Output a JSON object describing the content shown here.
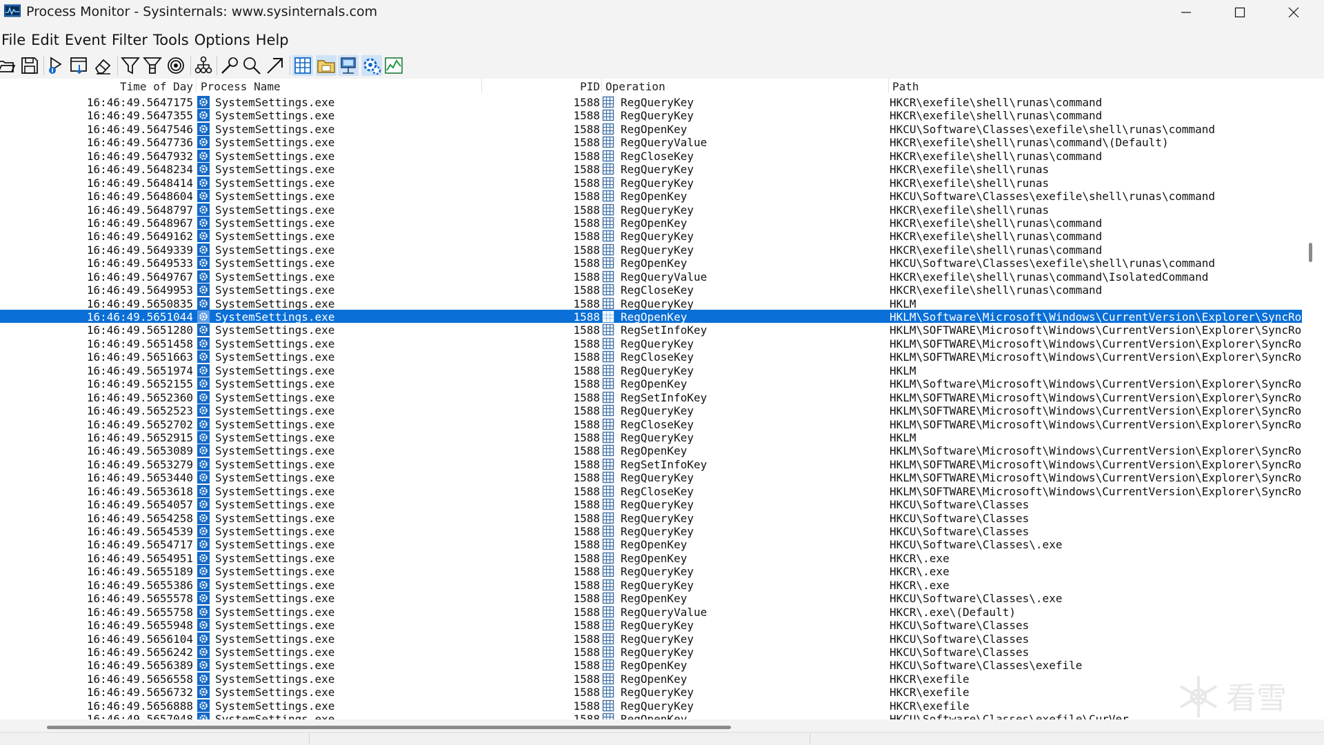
{
  "window": {
    "title": "Process Monitor - Sysinternals: www.sysinternals.com",
    "icon": "process-monitor-app-icon",
    "controls": [
      "minimize-icon",
      "maximize-icon",
      "close-icon"
    ]
  },
  "menu": [
    "File",
    "Edit",
    "Event",
    "Filter",
    "Tools",
    "Options",
    "Help"
  ],
  "toolbar": [
    {
      "name": "open-icon"
    },
    {
      "name": "save-icon"
    },
    {
      "name": "capture-icon"
    },
    {
      "name": "autoscroll-icon"
    },
    {
      "name": "clear-icon"
    },
    {
      "name": "filter-icon"
    },
    {
      "name": "highlight-icon"
    },
    {
      "name": "include-process-icon"
    },
    {
      "name": "process-tree-icon"
    },
    {
      "name": "find-icon"
    },
    {
      "name": "jump-to-icon"
    },
    {
      "name": "registry-activity-icon"
    },
    {
      "name": "file-system-activity-icon"
    },
    {
      "name": "network-activity-icon"
    },
    {
      "name": "process-thread-activity-icon"
    },
    {
      "name": "profiling-events-icon"
    }
  ],
  "columns": {
    "time": "Time of Day",
    "process": "Process Name",
    "pid": "PID",
    "operation": "Operation",
    "path": "Path"
  },
  "colors": {
    "selection": "#0a6fd6",
    "process_icon": "#1469c7",
    "op_icon": "#3d6fa8"
  },
  "rows": [
    {
      "time": "16:46:49.5647175",
      "process": "SystemSettings.exe",
      "pid": "1588",
      "op": "RegQueryKey",
      "path": "HKCR\\exefile\\shell\\runas\\command"
    },
    {
      "time": "16:46:49.5647355",
      "process": "SystemSettings.exe",
      "pid": "1588",
      "op": "RegQueryKey",
      "path": "HKCR\\exefile\\shell\\runas\\command"
    },
    {
      "time": "16:46:49.5647546",
      "process": "SystemSettings.exe",
      "pid": "1588",
      "op": "RegOpenKey",
      "path": "HKCU\\Software\\Classes\\exefile\\shell\\runas\\command"
    },
    {
      "time": "16:46:49.5647736",
      "process": "SystemSettings.exe",
      "pid": "1588",
      "op": "RegQueryValue",
      "path": "HKCR\\exefile\\shell\\runas\\command\\(Default)"
    },
    {
      "time": "16:46:49.5647932",
      "process": "SystemSettings.exe",
      "pid": "1588",
      "op": "RegCloseKey",
      "path": "HKCR\\exefile\\shell\\runas\\command"
    },
    {
      "time": "16:46:49.5648234",
      "process": "SystemSettings.exe",
      "pid": "1588",
      "op": "RegQueryKey",
      "path": "HKCR\\exefile\\shell\\runas"
    },
    {
      "time": "16:46:49.5648414",
      "process": "SystemSettings.exe",
      "pid": "1588",
      "op": "RegQueryKey",
      "path": "HKCR\\exefile\\shell\\runas"
    },
    {
      "time": "16:46:49.5648604",
      "process": "SystemSettings.exe",
      "pid": "1588",
      "op": "RegOpenKey",
      "path": "HKCU\\Software\\Classes\\exefile\\shell\\runas\\command"
    },
    {
      "time": "16:46:49.5648797",
      "process": "SystemSettings.exe",
      "pid": "1588",
      "op": "RegQueryKey",
      "path": "HKCR\\exefile\\shell\\runas"
    },
    {
      "time": "16:46:49.5648967",
      "process": "SystemSettings.exe",
      "pid": "1588",
      "op": "RegOpenKey",
      "path": "HKCR\\exefile\\shell\\runas\\command"
    },
    {
      "time": "16:46:49.5649162",
      "process": "SystemSettings.exe",
      "pid": "1588",
      "op": "RegQueryKey",
      "path": "HKCR\\exefile\\shell\\runas\\command"
    },
    {
      "time": "16:46:49.5649339",
      "process": "SystemSettings.exe",
      "pid": "1588",
      "op": "RegQueryKey",
      "path": "HKCR\\exefile\\shell\\runas\\command"
    },
    {
      "time": "16:46:49.5649533",
      "process": "SystemSettings.exe",
      "pid": "1588",
      "op": "RegOpenKey",
      "path": "HKCU\\Software\\Classes\\exefile\\shell\\runas\\command"
    },
    {
      "time": "16:46:49.5649767",
      "process": "SystemSettings.exe",
      "pid": "1588",
      "op": "RegQueryValue",
      "path": "HKCR\\exefile\\shell\\runas\\command\\IsolatedCommand"
    },
    {
      "time": "16:46:49.5649953",
      "process": "SystemSettings.exe",
      "pid": "1588",
      "op": "RegCloseKey",
      "path": "HKCR\\exefile\\shell\\runas\\command"
    },
    {
      "time": "16:46:49.5650835",
      "process": "SystemSettings.exe",
      "pid": "1588",
      "op": "RegQueryKey",
      "path": "HKLM"
    },
    {
      "time": "16:46:49.5651044",
      "process": "SystemSettings.exe",
      "pid": "1588",
      "op": "RegOpenKey",
      "path": "HKLM\\Software\\Microsoft\\Windows\\CurrentVersion\\Explorer\\SyncRoot\\",
      "selected": true
    },
    {
      "time": "16:46:49.5651280",
      "process": "SystemSettings.exe",
      "pid": "1588",
      "op": "RegSetInfoKey",
      "path": "HKLM\\SOFTWARE\\Microsoft\\Windows\\CurrentVersion\\Explorer\\SyncRoot\\"
    },
    {
      "time": "16:46:49.5651458",
      "process": "SystemSettings.exe",
      "pid": "1588",
      "op": "RegQueryKey",
      "path": "HKLM\\SOFTWARE\\Microsoft\\Windows\\CurrentVersion\\Explorer\\SyncRoot\\"
    },
    {
      "time": "16:46:49.5651663",
      "process": "SystemSettings.exe",
      "pid": "1588",
      "op": "RegCloseKey",
      "path": "HKLM\\SOFTWARE\\Microsoft\\Windows\\CurrentVersion\\Explorer\\SyncRoot\\"
    },
    {
      "time": "16:46:49.5651974",
      "process": "SystemSettings.exe",
      "pid": "1588",
      "op": "RegQueryKey",
      "path": "HKLM"
    },
    {
      "time": "16:46:49.5652155",
      "process": "SystemSettings.exe",
      "pid": "1588",
      "op": "RegOpenKey",
      "path": "HKLM\\Software\\Microsoft\\Windows\\CurrentVersion\\Explorer\\SyncRoot\\"
    },
    {
      "time": "16:46:49.5652360",
      "process": "SystemSettings.exe",
      "pid": "1588",
      "op": "RegSetInfoKey",
      "path": "HKLM\\SOFTWARE\\Microsoft\\Windows\\CurrentVersion\\Explorer\\SyncRoot\\"
    },
    {
      "time": "16:46:49.5652523",
      "process": "SystemSettings.exe",
      "pid": "1588",
      "op": "RegQueryKey",
      "path": "HKLM\\SOFTWARE\\Microsoft\\Windows\\CurrentVersion\\Explorer\\SyncRoot\\"
    },
    {
      "time": "16:46:49.5652702",
      "process": "SystemSettings.exe",
      "pid": "1588",
      "op": "RegCloseKey",
      "path": "HKLM\\SOFTWARE\\Microsoft\\Windows\\CurrentVersion\\Explorer\\SyncRoot\\"
    },
    {
      "time": "16:46:49.5652915",
      "process": "SystemSettings.exe",
      "pid": "1588",
      "op": "RegQueryKey",
      "path": "HKLM"
    },
    {
      "time": "16:46:49.5653089",
      "process": "SystemSettings.exe",
      "pid": "1588",
      "op": "RegOpenKey",
      "path": "HKLM\\Software\\Microsoft\\Windows\\CurrentVersion\\Explorer\\SyncRoot\\"
    },
    {
      "time": "16:46:49.5653279",
      "process": "SystemSettings.exe",
      "pid": "1588",
      "op": "RegSetInfoKey",
      "path": "HKLM\\SOFTWARE\\Microsoft\\Windows\\CurrentVersion\\Explorer\\SyncRoot\\"
    },
    {
      "time": "16:46:49.5653440",
      "process": "SystemSettings.exe",
      "pid": "1588",
      "op": "RegQueryKey",
      "path": "HKLM\\SOFTWARE\\Microsoft\\Windows\\CurrentVersion\\Explorer\\SyncRoot\\"
    },
    {
      "time": "16:46:49.5653618",
      "process": "SystemSettings.exe",
      "pid": "1588",
      "op": "RegCloseKey",
      "path": "HKLM\\SOFTWARE\\Microsoft\\Windows\\CurrentVersion\\Explorer\\SyncRoot\\"
    },
    {
      "time": "16:46:49.5654057",
      "process": "SystemSettings.exe",
      "pid": "1588",
      "op": "RegQueryKey",
      "path": "HKCU\\Software\\Classes"
    },
    {
      "time": "16:46:49.5654258",
      "process": "SystemSettings.exe",
      "pid": "1588",
      "op": "RegQueryKey",
      "path": "HKCU\\Software\\Classes"
    },
    {
      "time": "16:46:49.5654539",
      "process": "SystemSettings.exe",
      "pid": "1588",
      "op": "RegQueryKey",
      "path": "HKCU\\Software\\Classes"
    },
    {
      "time": "16:46:49.5654717",
      "process": "SystemSettings.exe",
      "pid": "1588",
      "op": "RegOpenKey",
      "path": "HKCU\\Software\\Classes\\.exe"
    },
    {
      "time": "16:46:49.5654951",
      "process": "SystemSettings.exe",
      "pid": "1588",
      "op": "RegOpenKey",
      "path": "HKCR\\.exe"
    },
    {
      "time": "16:46:49.5655189",
      "process": "SystemSettings.exe",
      "pid": "1588",
      "op": "RegQueryKey",
      "path": "HKCR\\.exe"
    },
    {
      "time": "16:46:49.5655386",
      "process": "SystemSettings.exe",
      "pid": "1588",
      "op": "RegQueryKey",
      "path": "HKCR\\.exe"
    },
    {
      "time": "16:46:49.5655578",
      "process": "SystemSettings.exe",
      "pid": "1588",
      "op": "RegOpenKey",
      "path": "HKCU\\Software\\Classes\\.exe"
    },
    {
      "time": "16:46:49.5655758",
      "process": "SystemSettings.exe",
      "pid": "1588",
      "op": "RegQueryValue",
      "path": "HKCR\\.exe\\(Default)"
    },
    {
      "time": "16:46:49.5655948",
      "process": "SystemSettings.exe",
      "pid": "1588",
      "op": "RegQueryKey",
      "path": "HKCU\\Software\\Classes"
    },
    {
      "time": "16:46:49.5656104",
      "process": "SystemSettings.exe",
      "pid": "1588",
      "op": "RegQueryKey",
      "path": "HKCU\\Software\\Classes"
    },
    {
      "time": "16:46:49.5656242",
      "process": "SystemSettings.exe",
      "pid": "1588",
      "op": "RegQueryKey",
      "path": "HKCU\\Software\\Classes"
    },
    {
      "time": "16:46:49.5656389",
      "process": "SystemSettings.exe",
      "pid": "1588",
      "op": "RegOpenKey",
      "path": "HKCU\\Software\\Classes\\exefile"
    },
    {
      "time": "16:46:49.5656558",
      "process": "SystemSettings.exe",
      "pid": "1588",
      "op": "RegOpenKey",
      "path": "HKCR\\exefile"
    },
    {
      "time": "16:46:49.5656732",
      "process": "SystemSettings.exe",
      "pid": "1588",
      "op": "RegQueryKey",
      "path": "HKCR\\exefile"
    },
    {
      "time": "16:46:49.5656888",
      "process": "SystemSettings.exe",
      "pid": "1588",
      "op": "RegQueryKey",
      "path": "HKCR\\exefile"
    },
    {
      "time": "16:46:49.5657048",
      "process": "SystemSettings.exe",
      "pid": "1588",
      "op": "RegOpenKey",
      "path": "HKCU\\Software\\Classes\\exefile\\CurVer"
    }
  ],
  "watermark": {
    "icon": "snowflake-watermark-icon",
    "text": "看雪"
  }
}
